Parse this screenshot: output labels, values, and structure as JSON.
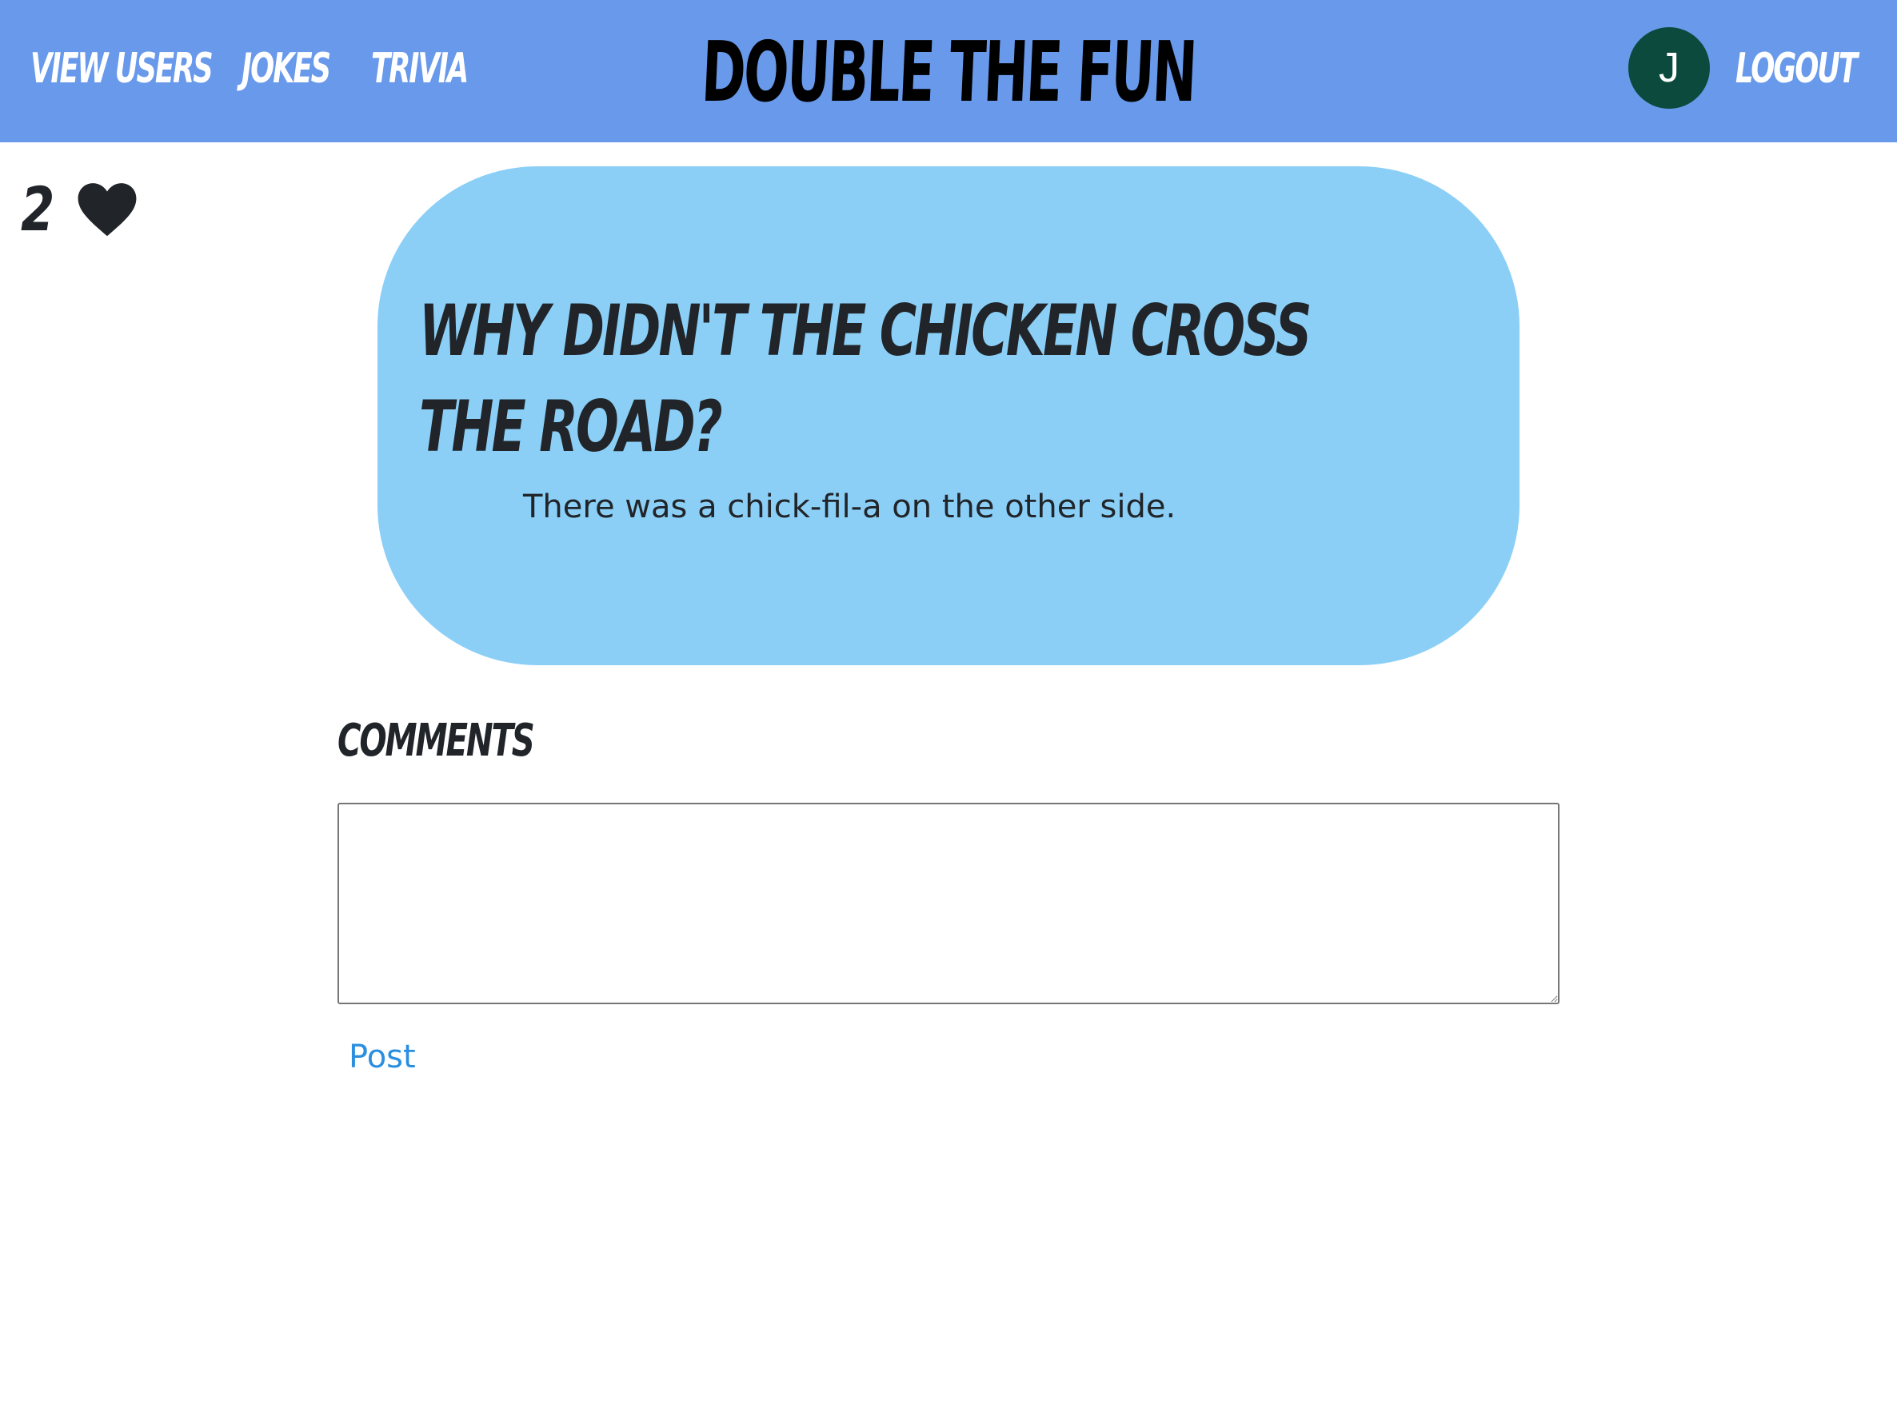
{
  "header": {
    "nav": {
      "view_users": "View Users",
      "jokes": "Jokes",
      "trivia": "Trivia",
      "logout": "Logout"
    },
    "brand": "Double the Fun",
    "avatar_initial": "J"
  },
  "likes": {
    "count": "2",
    "icon": "heart-icon"
  },
  "joke": {
    "question": "Why didn't the chicken cross the road?",
    "punchline": "There was a chick-fil-a on the other side."
  },
  "comments": {
    "heading": "Comments",
    "input_value": "",
    "post_label": "Post"
  },
  "colors": {
    "header_bg": "#6899eb",
    "card_bg": "#8bcff7",
    "avatar_bg": "#0b4a3c",
    "link": "#2b8fe0"
  }
}
